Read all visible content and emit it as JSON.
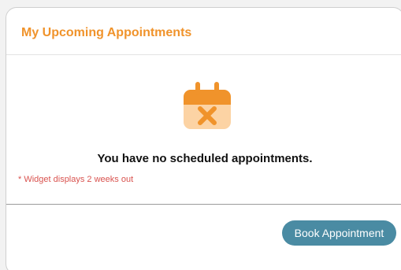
{
  "widget": {
    "title": "My Upcoming Appointments",
    "empty_message": "You have no scheduled appointments.",
    "note": "* Widget displays 2 weeks out",
    "icon": "calendar-x-icon"
  },
  "footer": {
    "book_label": "Book Appointment"
  },
  "colors": {
    "title": "#f0932b",
    "icon_dark": "#f0932b",
    "icon_light": "#fcd3a4",
    "note": "#d9534f",
    "button": "#4a8ba3"
  }
}
